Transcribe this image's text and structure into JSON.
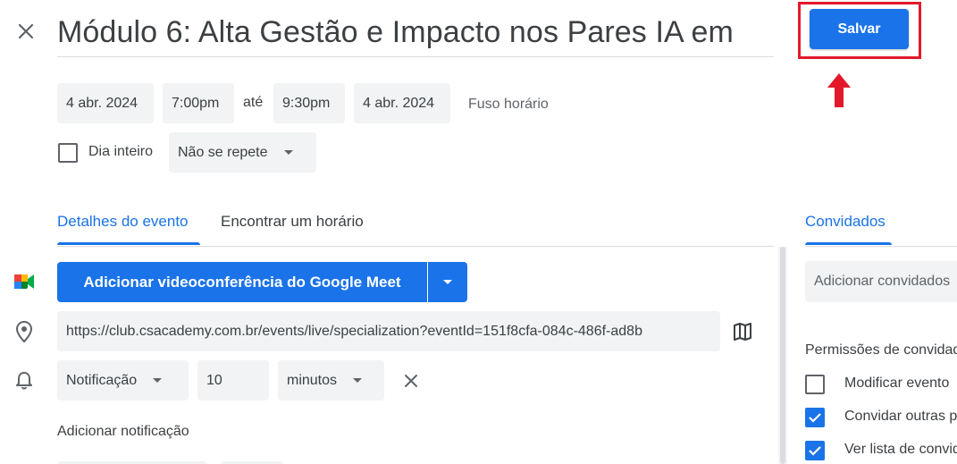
{
  "header": {
    "title": "Módulo 6: Alta Gestão e Impacto nos Pares   IA em",
    "save_label": "Salvar"
  },
  "dates": {
    "start_date": "4 abr. 2024",
    "start_time": "7:00pm",
    "until": "até",
    "end_time": "9:30pm",
    "end_date": "4 abr. 2024",
    "timezone": "Fuso horário"
  },
  "options": {
    "all_day_label": "Dia inteiro",
    "repeat_value": "Não se repete"
  },
  "tabs": {
    "details": "Detalhes do evento",
    "find_time": "Encontrar um horário",
    "guests": "Convidados"
  },
  "details": {
    "meet_button": "Adicionar videoconferência do Google Meet",
    "location": "https://club.csacademy.com.br/events/live/specialization?eventId=151f8cfa-084c-486f-ad8b",
    "notification_type": "Notificação",
    "notification_amount": "10",
    "notification_unit": "minutos",
    "add_notification": "Adicionar notificação"
  },
  "guests": {
    "add_placeholder": "Adicionar convidados",
    "permissions_title": "Permissões de convidados",
    "permissions": [
      {
        "label": "Modificar evento",
        "checked": false
      },
      {
        "label": "Convidar outras pessoas",
        "checked": true
      },
      {
        "label": "Ver lista de convidados",
        "checked": true
      }
    ]
  },
  "colors": {
    "accent": "#1a73e8",
    "highlight": "#e3192b",
    "field_bg": "#f1f3f4"
  },
  "icons": [
    "close-icon",
    "google-meet-icon",
    "location-pin-icon",
    "bell-icon",
    "map-icon",
    "clear-icon",
    "chevron-down-icon",
    "check-icon",
    "arrow-up-icon"
  ]
}
